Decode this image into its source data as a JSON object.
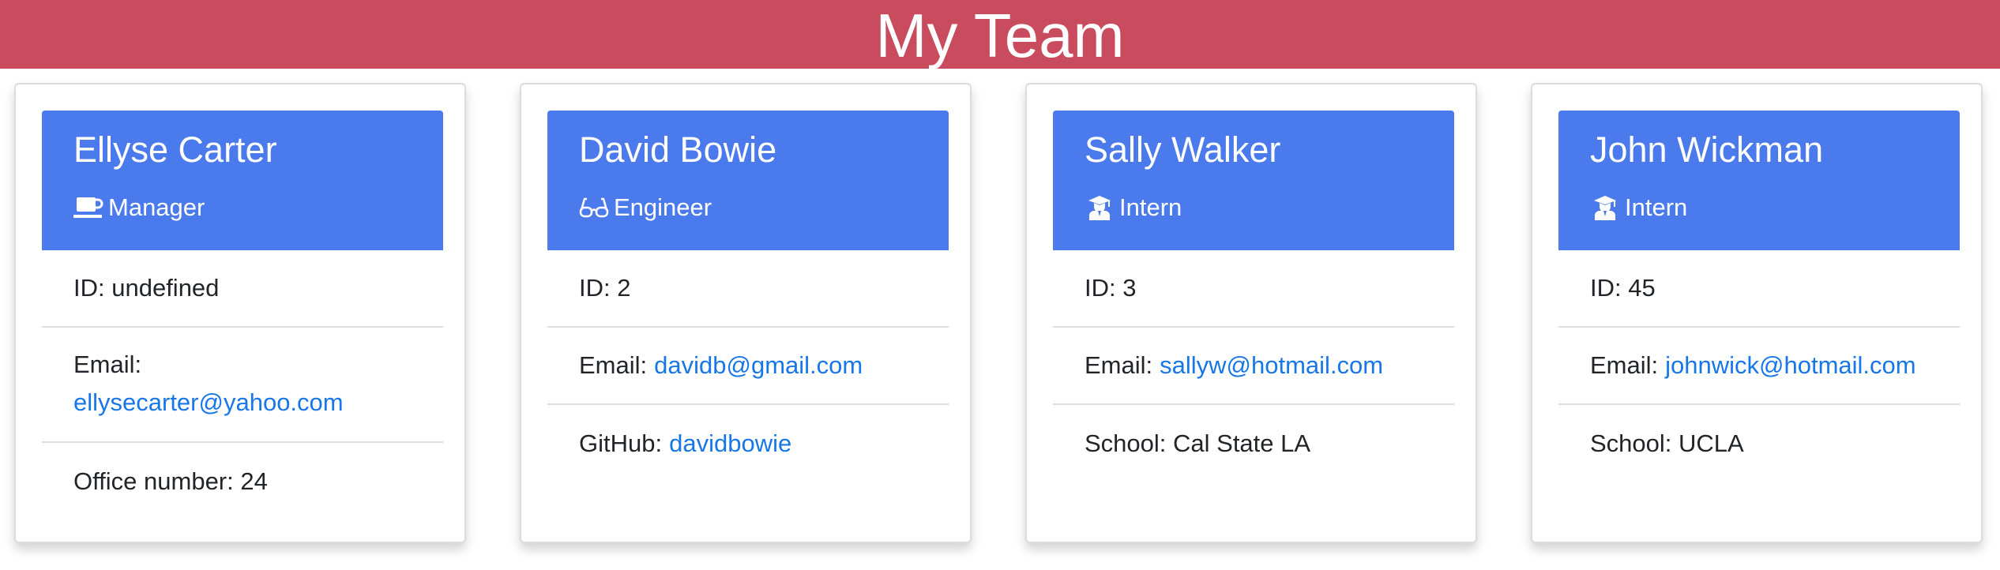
{
  "header": {
    "title": "My Team"
  },
  "colors": {
    "header_bg": "#c94c5e",
    "card_head_bg": "#4a7aeb",
    "link": "#1877e8"
  },
  "cards": [
    {
      "name": "Ellyse Carter",
      "role": "Manager",
      "role_icon": "coffee-mug-icon",
      "id": "ID: undefined",
      "email_label": "Email:",
      "email": "ellysecarter@yahoo.com",
      "extra": "Office number: 24"
    },
    {
      "name": "David Bowie",
      "role": "Engineer",
      "role_icon": "glasses-icon",
      "id": "ID: 2",
      "email_label": "Email:",
      "email": "davidb@gmail.com",
      "extra_label": "GitHub:",
      "extra_link": "davidbowie"
    },
    {
      "name": "Sally Walker",
      "role": "Intern",
      "role_icon": "graduate-icon",
      "id": "ID: 3",
      "email_label": "Email:",
      "email": "sallyw@hotmail.com",
      "extra": "School: Cal State LA"
    },
    {
      "name": "John Wickman",
      "role": "Intern",
      "role_icon": "graduate-icon",
      "id": "ID: 45",
      "email_label": "Email:",
      "email": "johnwick@hotmail.com",
      "extra": "School: UCLA"
    }
  ]
}
